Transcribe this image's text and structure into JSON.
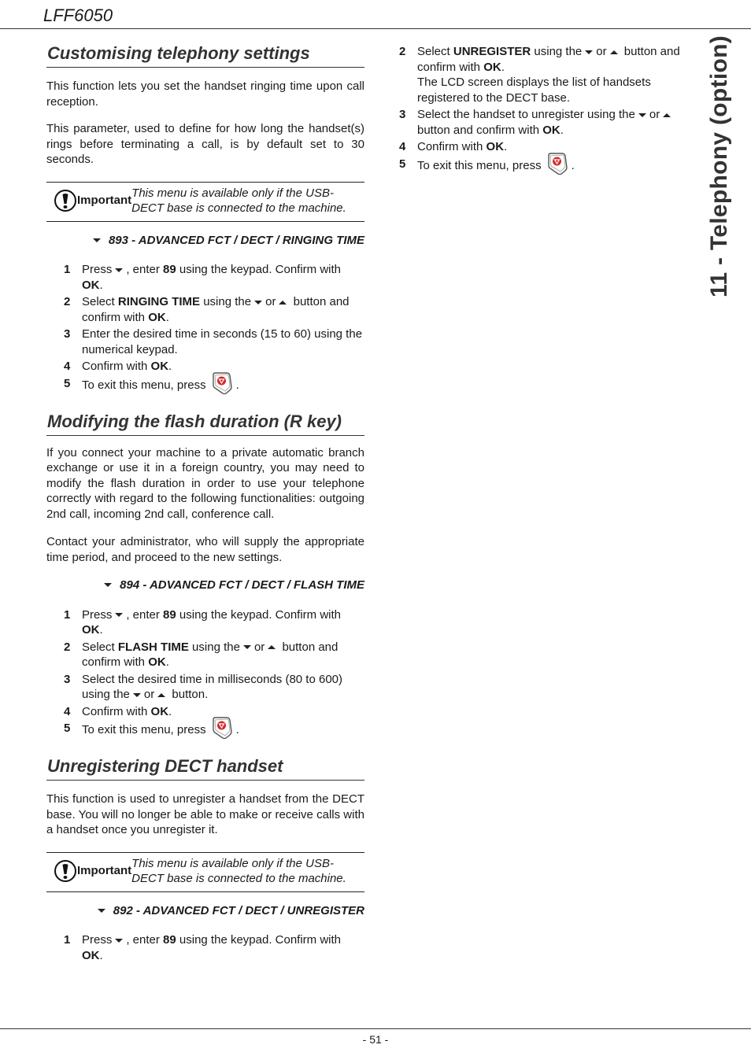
{
  "header": {
    "title": "LFF6050"
  },
  "side_tab": {
    "label": "11 - Telephony (option)"
  },
  "footer": {
    "page_number": "- 51 -"
  },
  "icons": {
    "arrow_down": "down-arrow-icon",
    "arrow_up": "up-arrow-icon",
    "stop_key": "stop-key-icon",
    "important": "exclamation-icon"
  },
  "sections": {
    "telephony": {
      "title": "Customising telephony settings",
      "paragraphs": [
        "This function lets you set the handset ringing time upon call reception.",
        "This parameter, used to define for how long the handset(s) rings before terminating a call, is by default set to 30 seconds."
      ],
      "important": {
        "label": "Important",
        "text": "This menu is available only if the USB-DECT base is connected to the machine."
      },
      "menu_path": "893 - ADVANCED FCT / DECT / RINGING TIME",
      "steps": [
        {
          "num": "1",
          "a": "Press",
          "b": ", enter",
          "bold1": "89",
          "c": "using the keypad. Confirm with",
          "bold2": "OK",
          "d": "."
        },
        {
          "num": "2",
          "a": "Select",
          "bold1": "RINGING TIME",
          "b": "using the",
          "c": "or",
          "d": "button and confirm with",
          "bold2": "OK",
          "e": "."
        },
        {
          "num": "3",
          "text": "Enter the desired time in seconds (15 to 60) using the numerical keypad."
        },
        {
          "num": "4",
          "a": "Confirm with",
          "bold1": "OK",
          "b": "."
        },
        {
          "num": "5",
          "a": "To exit this menu, press",
          "b": "."
        }
      ]
    },
    "flash": {
      "title": "Modifying the flash duration (R key)",
      "paragraphs": [
        "If you connect your machine to a private automatic branch exchange or use it in a foreign country, you may need to modify the flash duration in order to use your telephone correctly with regard to the following functionalities: outgoing 2nd call, incoming 2nd call, conference call.",
        "Contact your administrator, who will supply the appropriate time period, and proceed to the new settings."
      ],
      "menu_path": "894 - ADVANCED FCT / DECT / FLASH TIME",
      "steps": [
        {
          "num": "1",
          "a": "Press",
          "b": ", enter",
          "bold1": "89",
          "c": "using the keypad. Confirm with",
          "bold2": "OK",
          "d": "."
        },
        {
          "num": "2",
          "a": "Select",
          "bold1": "FLASH TIME",
          "b": "using the",
          "c": "or",
          "d": "button and confirm with",
          "bold2": "OK",
          "e": "."
        },
        {
          "num": "3",
          "a": "Select the desired time in milliseconds (80 to 600) using the",
          "b": "or",
          "c": "button."
        },
        {
          "num": "4",
          "a": "Confirm with",
          "bold1": "OK",
          "b": "."
        },
        {
          "num": "5",
          "a": "To exit this menu, press",
          "b": "."
        }
      ]
    },
    "unregister": {
      "title": "Unregistering DECT handset",
      "paragraphs": [
        "This function is used to unregister a handset from the DECT base. You will no longer be able to make or receive calls with a handset once you unregister it."
      ],
      "important": {
        "label": "Important",
        "text": "This menu is available only if the USB-DECT base is connected to the machine."
      },
      "menu_path": "892 - ADVANCED FCT / DECT / UNREGISTER",
      "steps": [
        {
          "num": "1",
          "a": "Press",
          "b": ", enter",
          "bold1": "89",
          "c": "using the keypad. Confirm with",
          "bold2": "OK",
          "d": "."
        },
        {
          "num": "2",
          "a": "Select",
          "bold1": "UNREGISTER",
          "b": "using the",
          "c": "or",
          "d": "button and confirm with",
          "bold2": "OK",
          "e": ".",
          "note": "The LCD screen displays the list of handsets registered to the DECT base."
        },
        {
          "num": "3",
          "a": "Select the handset to unregister using the",
          "b": "or",
          "c": "button and confirm with",
          "bold1": "OK",
          "d": "."
        },
        {
          "num": "4",
          "a": "Confirm with",
          "bold1": "OK",
          "b": "."
        },
        {
          "num": "5",
          "a": "To exit this menu, press",
          "b": "."
        }
      ]
    }
  }
}
